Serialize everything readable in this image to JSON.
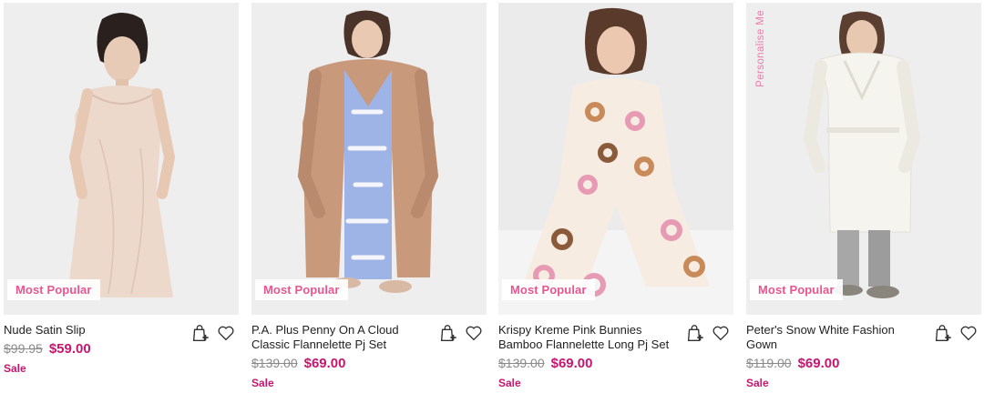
{
  "products": [
    {
      "name": "Nude Satin Slip",
      "old_price": "$99.95",
      "price": "$59.00",
      "sale_label": "Sale",
      "badge": "Most Popular",
      "image_icon": "model-satin-slip-photo",
      "colors": {
        "bg": "#eeeeee",
        "garment": "#ecd9cc",
        "accent": "#c9a898"
      }
    },
    {
      "name": "P.A. Plus Penny On A Cloud Classic Flannelette Pj Set",
      "old_price": "$139.00",
      "price": "$69.00",
      "sale_label": "Sale",
      "badge": "Most Popular",
      "image_icon": "model-robe-pj-photo",
      "colors": {
        "bg": "#eeeeee",
        "garment": "#c9997b",
        "accent": "#9fb4e6"
      }
    },
    {
      "name": "Krispy Kreme Pink Bunnies Bamboo Flannelette Long Pj Set",
      "old_price": "$139.00",
      "price": "$69.00",
      "sale_label": "Sale",
      "badge": "Most Popular",
      "image_icon": "model-donut-pj-photo",
      "colors": {
        "bg": "#ebebeb",
        "garment": "#f6ece1",
        "accent": "#e79ab3"
      }
    },
    {
      "name": "Peter's Snow White Fashion Gown",
      "old_price": "$119.00",
      "price": "$69.00",
      "sale_label": "Sale",
      "badge": "Most Popular",
      "vertical_tag": "Personalise Me",
      "image_icon": "model-white-gown-photo",
      "colors": {
        "bg": "#eeeeee",
        "garment": "#f6f4ef",
        "accent": "#a7a7a7"
      }
    }
  ],
  "icons": {
    "add_to_bag": "bag-plus-icon",
    "wishlist": "heart-icon"
  },
  "theme": {
    "pink": "#e8568f",
    "price_pink": "#c6166f",
    "muted": "#8a8a8a"
  }
}
